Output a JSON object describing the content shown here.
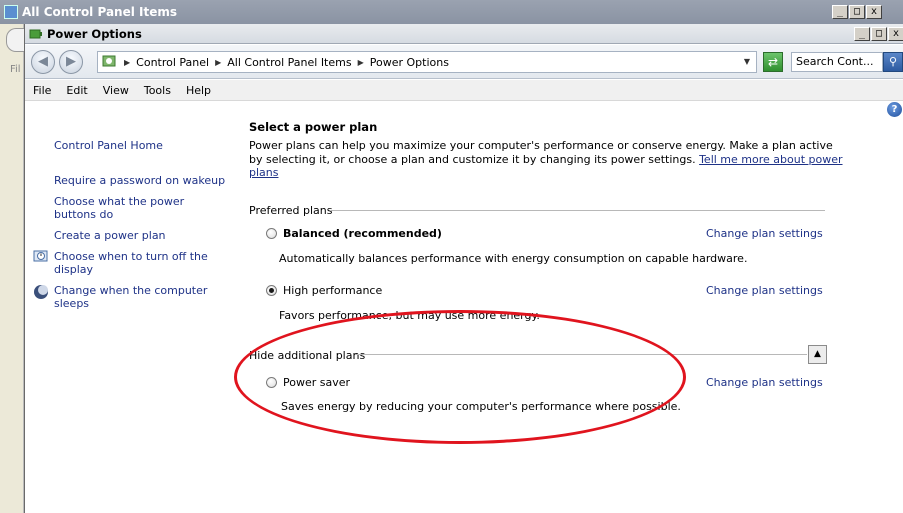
{
  "background_window": {
    "title": "All Control Panel Items",
    "left_strip_text": "Fil"
  },
  "window": {
    "title": "Power Options",
    "controls": {
      "minimize": "_",
      "maximize": "□",
      "close": "x"
    }
  },
  "address": {
    "breadcrumbs": [
      "Control Panel",
      "All Control Panel Items",
      "Power Options"
    ],
    "search_placeholder": "Search Cont..."
  },
  "menu": [
    "File",
    "Edit",
    "View",
    "Tools",
    "Help"
  ],
  "sidebar": {
    "home": "Control Panel Home",
    "tasks": [
      "Require a password on wakeup",
      "Choose what the power buttons do",
      "Create a power plan",
      "Choose when to turn off the display",
      "Change when the computer sleeps"
    ]
  },
  "main": {
    "heading": "Select a power plan",
    "intro": "Power plans can help you maximize your computer's performance or conserve energy. Make a plan active by selecting it, or choose a plan and customize it by changing its power settings.",
    "intro_link": "Tell me more about power plans",
    "preferred_label": "Preferred plans",
    "hidden_label": "Hide additional plans",
    "change_link": "Change plan settings",
    "plans": [
      {
        "name": "Balanced (recommended)",
        "description": "Automatically balances performance with energy consumption on capable hardware.",
        "selected": false
      },
      {
        "name": "High performance",
        "description": "Favors performance, but may use more energy.",
        "selected": true
      },
      {
        "name": "Power saver",
        "description": "Saves energy by reducing your computer's performance where possible.",
        "selected": false
      }
    ]
  },
  "colors": {
    "link": "#1e3287",
    "annotation": "#e0141e"
  }
}
